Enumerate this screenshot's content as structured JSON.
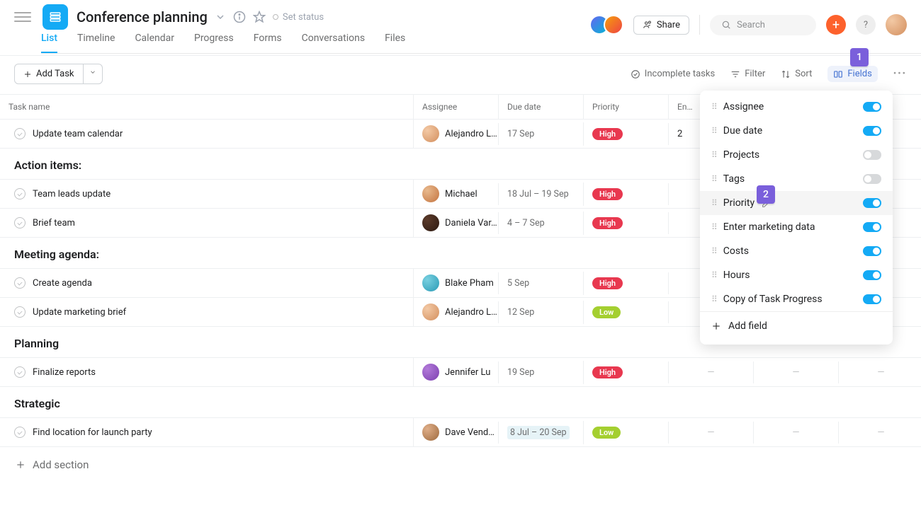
{
  "header": {
    "title": "Conference planning",
    "set_status": "Set status",
    "share": "Share",
    "search_placeholder": "Search"
  },
  "tabs": [
    "List",
    "Timeline",
    "Calendar",
    "Progress",
    "Forms",
    "Conversations",
    "Files"
  ],
  "active_tab": "List",
  "toolbar": {
    "add_task": "Add Task",
    "incomplete": "Incomplete tasks",
    "filter": "Filter",
    "sort": "Sort",
    "fields": "Fields"
  },
  "columns": [
    "Task name",
    "Assignee",
    "Due date",
    "Priority",
    "En…",
    "",
    ""
  ],
  "top_task": {
    "name": "Update team calendar",
    "assignee": "Alejandro L…",
    "due": "17 Sep",
    "priority": "High",
    "extra": "2"
  },
  "sections": [
    {
      "title": "Action items:",
      "tasks": [
        {
          "name": "Team leads update",
          "assignee": "Michael",
          "av": "av2",
          "due": "18 Jul – 19 Sep",
          "priority": "High",
          "dash": true
        },
        {
          "name": "Brief team",
          "assignee": "Daniela Var…",
          "av": "av3",
          "due": "4 – 7 Sep",
          "priority": "High",
          "dash": true
        }
      ]
    },
    {
      "title": "Meeting agenda:",
      "tasks": [
        {
          "name": "Create agenda",
          "assignee": "Blake Pham",
          "av": "av4",
          "due": "5 Sep",
          "priority": "High",
          "dash": true
        },
        {
          "name": "Update marketing brief",
          "assignee": "Alejandro L…",
          "av": "av1",
          "due": "12 Sep",
          "priority": "Low",
          "dash": true
        }
      ]
    },
    {
      "title": "Planning",
      "tasks": [
        {
          "name": "Finalize reports",
          "assignee": "Jennifer Lu",
          "av": "av5",
          "due": "19 Sep",
          "priority": "High",
          "dash3": true
        }
      ]
    },
    {
      "title": "Strategic",
      "tasks": [
        {
          "name": "Find location for launch party",
          "assignee": "Dave Vend…",
          "av": "av6",
          "due": "8 Jul – 20 Sep",
          "due_hl": true,
          "priority": "Low",
          "dash3": true
        }
      ]
    }
  ],
  "add_section": "Add section",
  "fields_menu": [
    {
      "label": "Assignee",
      "on": true
    },
    {
      "label": "Due date",
      "on": true
    },
    {
      "label": "Projects",
      "on": false
    },
    {
      "label": "Tags",
      "on": false
    },
    {
      "label": "Priority",
      "on": true,
      "hl": true,
      "pencil": true
    },
    {
      "label": "Enter marketing data",
      "on": true
    },
    {
      "label": "Costs",
      "on": true
    },
    {
      "label": "Hours",
      "on": true
    },
    {
      "label": "Copy of Task Progress",
      "on": true
    }
  ],
  "add_field": "Add field",
  "callouts": {
    "one": "1",
    "two": "2"
  }
}
